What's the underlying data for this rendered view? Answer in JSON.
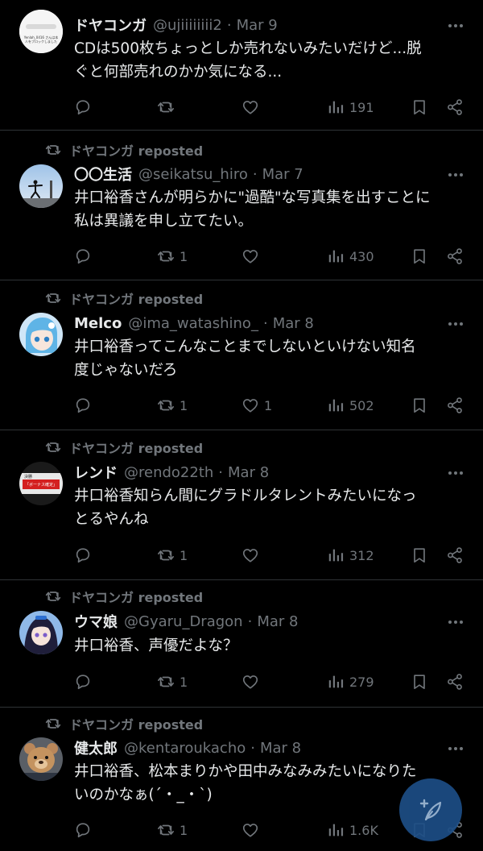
{
  "tweets": [
    {
      "reposted_by": "",
      "name": "ドヤコンガ",
      "handle": "@ujiiiiiiii2",
      "date": "Mar 9",
      "text": "CDは500枚ちょっとしか売れないみたいだけど...脱\nぐと何部売れのかか気になる...",
      "replies": "",
      "reposts": "",
      "likes": "",
      "views": "191"
    },
    {
      "reposted_by": "ドヤコンガ reposted",
      "name": "〇〇生活",
      "handle": "@seikatsu_hiro",
      "date": "Mar 7",
      "text": "井口裕香さんが明らかに\"過酷\"な写真集を出すことに\n私は異議を申し立てたい。",
      "replies": "",
      "reposts": "1",
      "likes": "",
      "views": "430"
    },
    {
      "reposted_by": "ドヤコンガ reposted",
      "name": "Melco",
      "handle": "@ima_watashino_",
      "date": "Mar 8",
      "text": "井口裕香ってこんなことまでしないといけない知名\n度じゃないだろ",
      "replies": "",
      "reposts": "1",
      "likes": "1",
      "views": "502"
    },
    {
      "reposted_by": "ドヤコンガ reposted",
      "name": "レンド",
      "handle": "@rendo22th",
      "date": "Mar 8",
      "text": "井口裕香知らん間にグラドルタレントみたいになっ\nとるやんね",
      "replies": "",
      "reposts": "1",
      "likes": "",
      "views": "312"
    },
    {
      "reposted_by": "ドヤコンガ reposted",
      "name": "ウマ娘",
      "handle": "@Gyaru_Dragon",
      "date": "Mar 8",
      "text": "井口裕香、声優だよな？",
      "replies": "",
      "reposts": "1",
      "likes": "",
      "views": "279"
    },
    {
      "reposted_by": "ドヤコンガ reposted",
      "name": "健太郎",
      "handle": "@kentaroukacho",
      "date": "Mar 8",
      "text": "井口裕香、松本まりかや田中みなみみたいになりた\nいのかなぁ(´・_・`)",
      "replies": "",
      "reposts": "1",
      "likes": "",
      "views": "1.6K"
    }
  ],
  "avatar_texts": {
    "a1_line1": "Yenlah_0416 さんは本",
    "a1_line2": "人をブロックしました",
    "a4_line1": "決勝",
    "a4_line2": "「ボーナス確定」"
  },
  "colors": {
    "background": "#000000",
    "text": "#e7e9ea",
    "muted": "#71767b",
    "divider": "#2f3336",
    "fab": "#1d4e86"
  }
}
